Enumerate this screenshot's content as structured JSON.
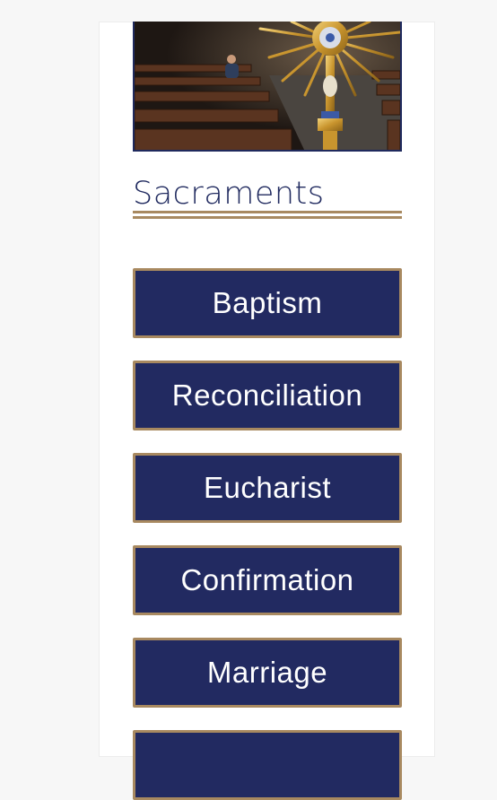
{
  "colors": {
    "navy": "#222a61",
    "gold": "#a88960",
    "heading": "#202a5f",
    "page_bg": "#f7f7f7"
  },
  "section": {
    "title": "Sacraments"
  },
  "buttons": [
    {
      "label": "Baptism"
    },
    {
      "label": "Reconciliation"
    },
    {
      "label": "Eucharist"
    },
    {
      "label": "Confirmation"
    },
    {
      "label": "Marriage"
    },
    {
      "label": ""
    }
  ]
}
